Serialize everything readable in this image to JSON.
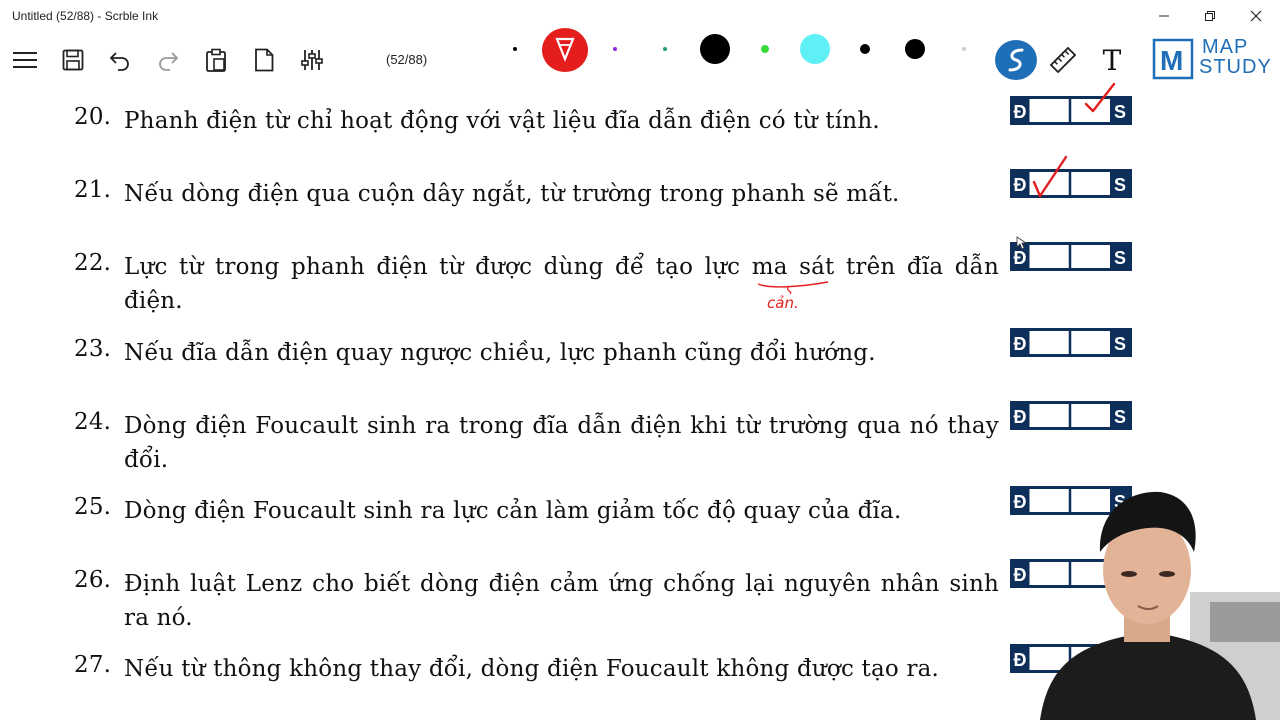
{
  "window": {
    "title": "Untitled (52/88) - Scrble Ink",
    "minimize_label": "–",
    "restore_label": "❐",
    "close_label": "✕"
  },
  "toolbar": {
    "page_indicator": "(52/88)",
    "tools": [
      "menu-icon",
      "save-icon",
      "undo-icon",
      "redo-icon",
      "clipboard-icon",
      "new-page-icon",
      "settings-sliders-icon"
    ],
    "colors": [
      "#000000",
      "#e41d1d",
      "#8a2be2",
      "#1a9e7a",
      "#000000",
      "#39d93a",
      "#5ff0f5",
      "#000000",
      "#000000",
      "#cccccc"
    ],
    "right_tools": [
      "pen-icon",
      "ruler-icon",
      "text-icon"
    ],
    "text_tool_label": "T"
  },
  "logo": {
    "line1": "MAP",
    "line2": "STUDY",
    "mark": "M"
  },
  "answer_box": {
    "left": "Đ",
    "right": "S"
  },
  "questions": [
    {
      "num": "20.",
      "text": "Phanh điện từ chỉ hoạt động với vật liệu đĩa dẫn điện có từ tính.",
      "mark": "S"
    },
    {
      "num": "21.",
      "text": "Nếu dòng điện qua cuộn dây ngắt, từ trường trong phanh sẽ mất.",
      "mark": "D"
    },
    {
      "num": "22.",
      "text": "Lực từ trong phanh điện từ được dùng để tạo lực ma sát trên đĩa dẫn điện.",
      "mark": ""
    },
    {
      "num": "23.",
      "text": "Nếu đĩa dẫn điện quay ngược chiều, lực phanh cũng đổi hướng.",
      "mark": ""
    },
    {
      "num": "24.",
      "text": "Dòng điện Foucault sinh ra trong đĩa dẫn điện khi từ trường qua nó thay đổi.",
      "mark": ""
    },
    {
      "num": "25.",
      "text": "Dòng điện Foucault sinh ra lực cản làm giảm tốc độ quay của đĩa.",
      "mark": ""
    },
    {
      "num": "26.",
      "text": "Định luật Lenz cho biết dòng điện cảm ứng chống lại nguyên nhân sinh ra nó.",
      "mark": ""
    },
    {
      "num": "27.",
      "text": "Nếu từ thông không thay đổi, dòng điện Foucault không được tạo ra.",
      "mark": ""
    }
  ],
  "annotation": {
    "handwritten": "cản."
  }
}
